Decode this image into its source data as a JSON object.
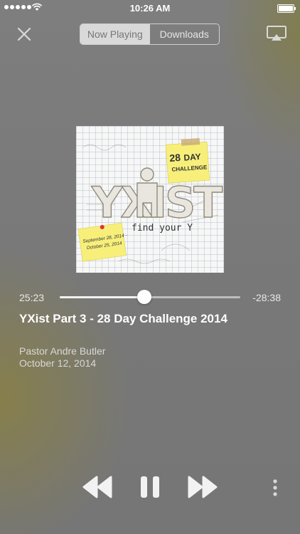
{
  "status_bar": {
    "time": "10:26 AM"
  },
  "tabs": [
    {
      "label": "Now Playing",
      "active": true
    },
    {
      "label": "Downloads",
      "active": false
    }
  ],
  "artwork": {
    "wordmark": "YXIST",
    "tagline": "find your Y",
    "note_dates": "September 28, 2014 - October 25, 2014",
    "badge": "THE 28 DAY CHALLENGE"
  },
  "player": {
    "elapsed": "25:23",
    "remaining": "-28:38",
    "progress": 0.47,
    "title": "YXist Part 3 - 28 Day Challenge 2014",
    "speaker": "Pastor Andre Butler",
    "date": "October 12, 2014"
  },
  "icons": {
    "close": "close-icon",
    "airplay": "airplay-icon",
    "rewind": "rewind-icon",
    "pause": "pause-icon",
    "forward": "fast-forward-icon",
    "more": "more-vertical-icon"
  },
  "colors": {
    "note_yellow": "#f7ef7a",
    "accent": "#ffffff"
  }
}
